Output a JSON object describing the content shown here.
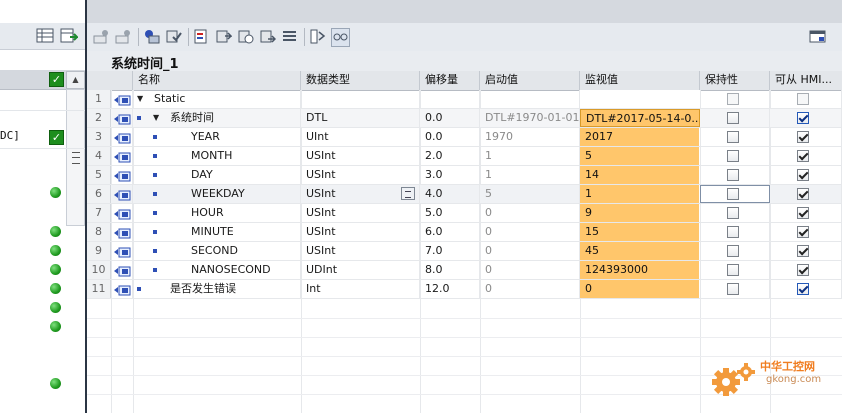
{
  "block": {
    "title": "系统时间_1"
  },
  "left_pane": {
    "dc_label": "DC]"
  },
  "columns": {
    "name": "名称",
    "data_type": "数据类型",
    "offset": "偏移量",
    "start_value": "启动值",
    "monitor_value": "监视值",
    "retain": "保持性",
    "hmi": "可从 HMI..."
  },
  "rows": [
    {
      "num": "1",
      "name": "Static",
      "type": "",
      "offset": "",
      "start": "",
      "monitor": "",
      "retain": false,
      "hmi": false
    },
    {
      "num": "2",
      "name": "系统时间",
      "type": "DTL",
      "offset": "0.0",
      "start": "DTL#1970-01-01-(",
      "monitor": "DTL#2017-05-14-0...",
      "retain": false,
      "hmi": true
    },
    {
      "num": "3",
      "name": "YEAR",
      "type": "UInt",
      "offset": "0.0",
      "start": "1970",
      "monitor": "2017",
      "retain": false,
      "hmi": true
    },
    {
      "num": "4",
      "name": "MONTH",
      "type": "USInt",
      "offset": "2.0",
      "start": "1",
      "monitor": "5",
      "retain": false,
      "hmi": true
    },
    {
      "num": "5",
      "name": "DAY",
      "type": "USInt",
      "offset": "3.0",
      "start": "1",
      "monitor": "14",
      "retain": false,
      "hmi": true
    },
    {
      "num": "6",
      "name": "WEEKDAY",
      "type": "USInt",
      "offset": "4.0",
      "start": "5",
      "monitor": "1",
      "retain": false,
      "hmi": true
    },
    {
      "num": "7",
      "name": "HOUR",
      "type": "USInt",
      "offset": "5.0",
      "start": "0",
      "monitor": "9",
      "retain": false,
      "hmi": true
    },
    {
      "num": "8",
      "name": "MINUTE",
      "type": "USInt",
      "offset": "6.0",
      "start": "0",
      "monitor": "15",
      "retain": false,
      "hmi": true
    },
    {
      "num": "9",
      "name": "SECOND",
      "type": "USInt",
      "offset": "7.0",
      "start": "0",
      "monitor": "45",
      "retain": false,
      "hmi": true
    },
    {
      "num": "10",
      "name": "NANOSECOND",
      "type": "UDInt",
      "offset": "8.0",
      "start": "0",
      "monitor": "124393000",
      "retain": false,
      "hmi": true
    },
    {
      "num": "11",
      "name": "是否发生错误",
      "type": "Int",
      "offset": "12.0",
      "start": "0",
      "monitor": "0",
      "retain": false,
      "hmi": true
    }
  ],
  "watermark": {
    "cn": "中华工控网",
    "url": "gkong.com"
  },
  "colors": {
    "monitor_bg": "#ffc66b",
    "accent_blue": "#2459b8",
    "status_green": "#1f9a1f"
  }
}
